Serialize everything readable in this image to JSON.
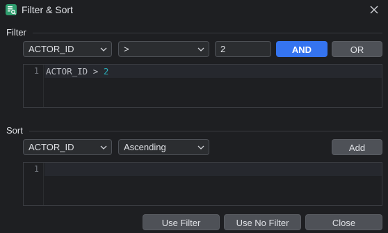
{
  "window": {
    "title": "Filter & Sort"
  },
  "filter": {
    "label": "Filter",
    "column": "ACTOR_ID",
    "operator": ">",
    "value": "2",
    "and_label": "AND",
    "or_label": "OR",
    "editor": {
      "line_number": "1",
      "column": "ACTOR_ID",
      "operator": ">",
      "value": "2"
    }
  },
  "sort": {
    "label": "Sort",
    "column": "ACTOR_ID",
    "order": "Ascending",
    "add_label": "Add",
    "editor": {
      "line_number": "1"
    }
  },
  "footer": {
    "use_filter": "Use Filter",
    "use_no_filter": "Use No Filter",
    "close": "Close"
  },
  "colors": {
    "background": "#1e1f22",
    "primary_button": "#3574f0",
    "app_icon": "#2f9e6e",
    "number_token": "#2aacb8"
  },
  "icons": {
    "app": "filter-sort-table-icon",
    "close": "close-icon",
    "dropdown": "chevron-down-icon"
  }
}
